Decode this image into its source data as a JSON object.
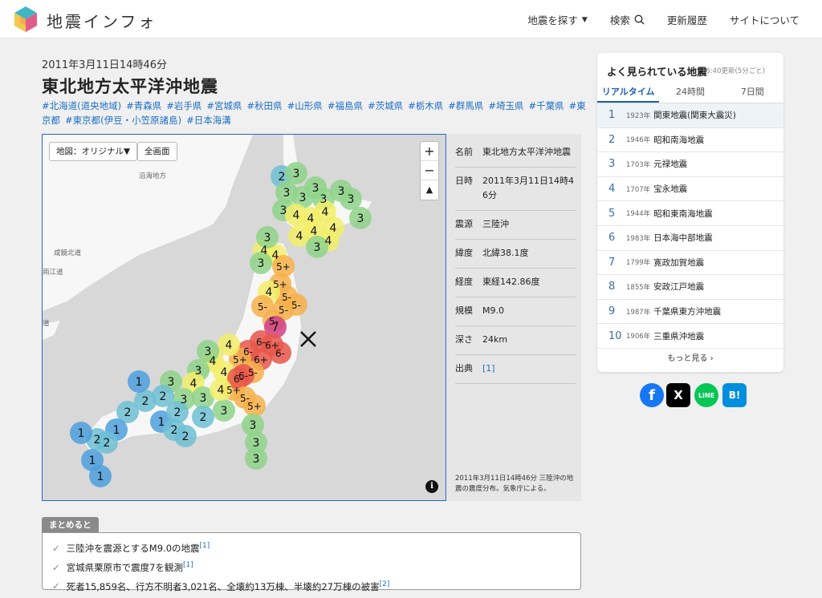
{
  "header": {
    "brand": "地震インフォ",
    "nav": {
      "search_eq": "地震を探す",
      "search": "検索",
      "updates": "更新履歴",
      "about": "サイトについて"
    }
  },
  "article": {
    "date": "2011年3月11日14時46分",
    "title": "東北地方太平洋沖地震",
    "tags": [
      "#北海道(道央地域)",
      "#青森県",
      "#岩手県",
      "#宮城県",
      "#秋田県",
      "#山形県",
      "#福島県",
      "#茨城県",
      "#栃木県",
      "#群馬県",
      "#埼玉県",
      "#千葉県",
      "#東京都",
      "#東京都(伊豆・小笠原諸島)",
      "#日本海溝"
    ]
  },
  "map": {
    "layer_button": "地図：オリジナル▼",
    "fullscreen_button": "全画面",
    "zoom_in": "+",
    "zoom_out": "−",
    "compass": "▲",
    "info": "i",
    "labels": [
      "沿海地方",
      "咸鏡北道",
      "両江道",
      "道"
    ]
  },
  "info": {
    "rows": [
      {
        "key": "名前",
        "value": "東北地方太平洋沖地震"
      },
      {
        "key": "日時",
        "value": "2011年3月11日14時46分"
      },
      {
        "key": "震源",
        "value": "三陸沖"
      },
      {
        "key": "緯度",
        "value": "北緯38.1度"
      },
      {
        "key": "経度",
        "value": "東経142.86度"
      },
      {
        "key": "規模",
        "value": "M9.0"
      },
      {
        "key": "深さ",
        "value": "24km"
      },
      {
        "key": "出典",
        "value": "[1]"
      }
    ],
    "caption": "2011年3月11日14時46分 三陸沖の地震の震度分布。気象庁による。"
  },
  "summary": {
    "tab": "まとめると",
    "items": [
      {
        "text": "三陸沖を震源とするM9.0の地震",
        "ref": "[1]"
      },
      {
        "text": "宮城県栗原市で震度7を観測",
        "ref": "[1]"
      },
      {
        "text": "死者15,859名、行方不明者3,021名、全壊約13万棟、半壊約27万棟の被害",
        "ref": "[2]"
      }
    ]
  },
  "sidebar": {
    "title": "よく見られている地震",
    "updated": "16:40更新(5分ごと)",
    "tabs": [
      "リアルタイム",
      "24時間",
      "7日間"
    ],
    "ranking": [
      {
        "rank": "1",
        "year": "1923年",
        "name": "関東地震(関東大震災)"
      },
      {
        "rank": "2",
        "year": "1946年",
        "name": "昭和南海地震"
      },
      {
        "rank": "3",
        "year": "1703年",
        "name": "元禄地震"
      },
      {
        "rank": "4",
        "year": "1707年",
        "name": "宝永地震"
      },
      {
        "rank": "5",
        "year": "1944年",
        "name": "昭和東南海地震"
      },
      {
        "rank": "6",
        "year": "1983年",
        "name": "日本海中部地震"
      },
      {
        "rank": "7",
        "year": "1799年",
        "name": "寛政加賀地震"
      },
      {
        "rank": "8",
        "year": "1855年",
        "name": "安政江戸地震"
      },
      {
        "rank": "9",
        "year": "1987年",
        "name": "千葉県東方沖地震"
      },
      {
        "rank": "10",
        "year": "1906年",
        "name": "三重県沖地震"
      }
    ],
    "more": "もっと見る ›"
  },
  "share": {
    "facebook": "f",
    "x": "X",
    "line": "LINE",
    "hatena": "B!"
  },
  "colors": {
    "link": "#1c6fc4",
    "intensity_1": "#4ea0dd",
    "intensity_2": "#6fc0d4",
    "intensity_3": "#8fd48a",
    "intensity_4": "#f2ee6a",
    "intensity_5": "#f6b04a",
    "intensity_6": "#e8564a",
    "intensity_7": "#d0408a"
  }
}
